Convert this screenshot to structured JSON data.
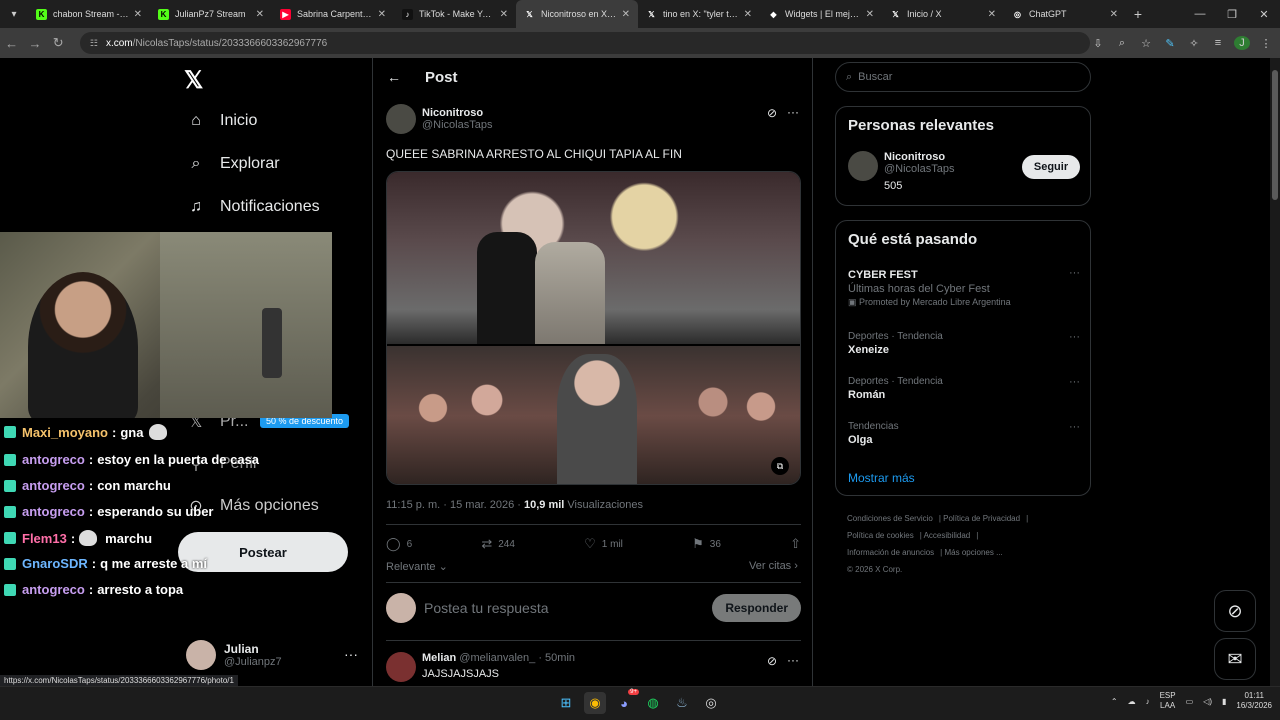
{
  "browser": {
    "tabs": [
      {
        "title": "chabon Stream - Wa",
        "color": "#53fc18",
        "glyph": "K",
        "active": false
      },
      {
        "title": "JulianPz7 Stream",
        "color": "#53fc18",
        "glyph": "K",
        "active": false
      },
      {
        "title": "Sabrina Carpenter - P",
        "color": "#ff0033",
        "glyph": "▶",
        "active": false
      },
      {
        "title": "TikTok - Make Your D",
        "color": "#111111",
        "glyph": "♪",
        "active": false
      },
      {
        "title": "Niconitroso en X: \"Q",
        "color": "#000000",
        "glyph": "𝕏",
        "active": true
      },
      {
        "title": "tino en X: \"tyler the c",
        "color": "#000000",
        "glyph": "𝕏",
        "active": false
      },
      {
        "title": "Widgets | El mejor so",
        "color": "#ffffff",
        "glyph": "◆",
        "active": false
      },
      {
        "title": "Inicio / X",
        "color": "#000000",
        "glyph": "𝕏",
        "active": false
      },
      {
        "title": "ChatGPT",
        "color": "#ffffff",
        "glyph": "◎",
        "active": false
      }
    ],
    "url_host": "x.com",
    "url_path": "/NicolasTaps/status/2033366603362967776",
    "profile_initial": "J",
    "status_url": "https://x.com/NicolasTaps/status/2033366603362967776/photo/1"
  },
  "leftnav": {
    "items": [
      {
        "label": "Inicio",
        "icon": "home-icon"
      },
      {
        "label": "Explorar",
        "icon": "search-icon"
      },
      {
        "label": "Notificaciones",
        "icon": "bell-icon"
      }
    ],
    "partial_premium": "Pr...",
    "partial_perfil": "Perfil",
    "more": "Más opciones",
    "badge": "50 % de descuento",
    "post_button": "Postear",
    "user_name": "Julian",
    "user_handle": "@Julianpz7"
  },
  "chat": [
    {
      "user": "Maxi_moyano",
      "color": "#f5c26b",
      "msg": "gna",
      "emote": true
    },
    {
      "user": "antogreco",
      "color": "#c79ef0",
      "msg": "estoy en la puerta de casa",
      "emote": false
    },
    {
      "user": "antogreco",
      "color": "#c79ef0",
      "msg": "con marchu",
      "emote": false
    },
    {
      "user": "antogreco",
      "color": "#c79ef0",
      "msg": "esperando su uber",
      "emote": false
    },
    {
      "user": "Flem13",
      "color": "#ff6fa8",
      "msg": "marchu",
      "emote": true
    },
    {
      "user": "GnaroSDR",
      "color": "#6db6ff",
      "msg": "q me arreste a mí",
      "emote": false
    },
    {
      "user": "antogreco",
      "color": "#c79ef0",
      "msg": "arresto a topa",
      "emote": false
    }
  ],
  "post": {
    "header": "Post",
    "author_name": "Niconitroso",
    "author_handle": "@NicolasTaps",
    "text": "QUEEE SABRINA ARRESTO AL CHIQUI TAPIA AL FIN",
    "time": "11:15 p. m. · 15 mar. 2026 · ",
    "views": "10,9 mil",
    "views_label": " Visualizaciones",
    "replies": "6",
    "reposts": "244",
    "likes": "1 mil",
    "bookmarks": "36",
    "sort": "Relevante",
    "quotes": "Ver citas",
    "reply_placeholder": "Postea tu respuesta",
    "reply_button": "Responder"
  },
  "comment": {
    "name": "Melian",
    "handle": "@melianvalen_ · 50min",
    "text": "JAJSJAJSJAJS"
  },
  "sidebar": {
    "search_placeholder": "Buscar",
    "relevant_title": "Personas relevantes",
    "person_name": "Niconitroso",
    "person_handle": "@NicolasTaps",
    "person_count": "505",
    "follow": "Seguir",
    "trending_title": "Qué está pasando",
    "trends": [
      {
        "context": "",
        "title": "CYBER FEST",
        "sub": "Últimas horas del Cyber Fest",
        "promo": "Promoted by Mercado Libre Argentina"
      },
      {
        "context": "Deportes · Tendencia",
        "title": "Xeneize",
        "sub": "",
        "promo": ""
      },
      {
        "context": "Deportes · Tendencia",
        "title": "Román",
        "sub": "",
        "promo": ""
      },
      {
        "context": "Tendencias",
        "title": "Olga",
        "sub": "",
        "promo": ""
      }
    ],
    "show_more": "Mostrar más",
    "footer": [
      "Condiciones de Servicio",
      "Política de Privacidad",
      "Política de cookies",
      "Accesibilidad",
      "Información de anuncios",
      "Más opciones ...",
      "© 2026 X Corp."
    ]
  },
  "taskbar": {
    "lang1": "ESP",
    "lang2": "LAA",
    "time": "01:11",
    "date": "16/3/2026",
    "discord_badge": "9+"
  }
}
